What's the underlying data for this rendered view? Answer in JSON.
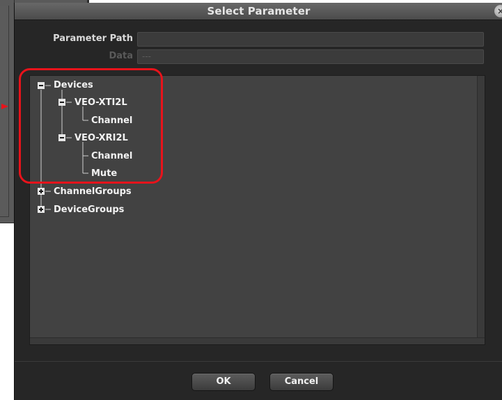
{
  "dialog": {
    "title": "Select Parameter",
    "close_icon": "close-icon"
  },
  "form": {
    "parameter_path_label": "Parameter Path",
    "parameter_path_value": "",
    "data_label": "Data",
    "data_value": "---"
  },
  "tree": {
    "nodes": [
      {
        "label": "Devices",
        "expanded": true
      },
      {
        "label": "VEO-XTI2L",
        "expanded": true
      },
      {
        "label": "Channel"
      },
      {
        "label": "VEO-XRI2L",
        "expanded": true
      },
      {
        "label": "Channel"
      },
      {
        "label": "Mute"
      },
      {
        "label": "ChannelGroups",
        "expanded": false
      },
      {
        "label": "DeviceGroups",
        "expanded": false
      }
    ]
  },
  "buttons": {
    "ok": "OK",
    "cancel": "Cancel"
  },
  "colors": {
    "highlight": "#e8131b",
    "dialog_bg": "#262626",
    "tree_bg": "#424242"
  }
}
